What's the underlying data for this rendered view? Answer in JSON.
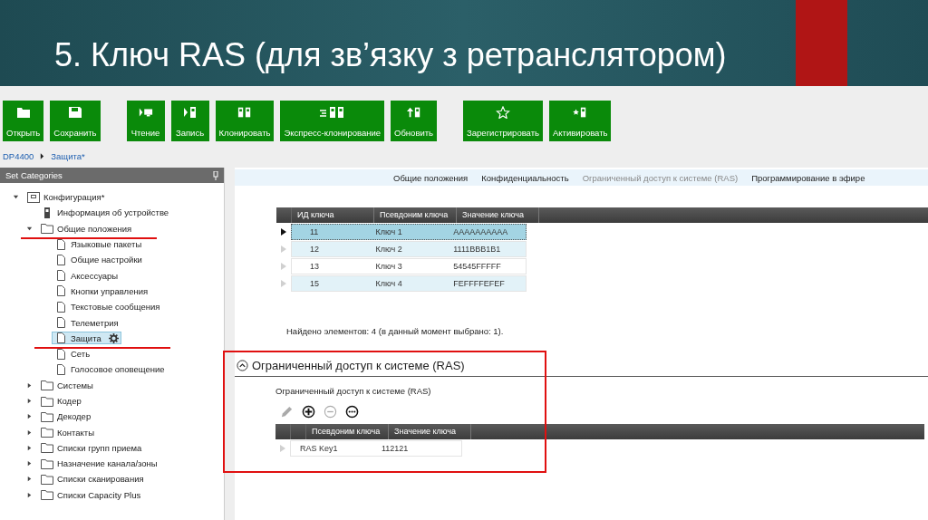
{
  "slide": {
    "title": "5. Ключ RAS (для зв’язку з ретранслятором)"
  },
  "toolbar": [
    [
      {
        "label": "Открыть",
        "kind": "open"
      },
      {
        "label": "Сохранить",
        "kind": "save"
      }
    ],
    [
      {
        "label": "Чтение",
        "kind": "read"
      },
      {
        "label": "Запись",
        "kind": "write"
      },
      {
        "label": "Клонировать",
        "kind": "clone"
      },
      {
        "label": "Экспресс-клонирование",
        "kind": "express"
      },
      {
        "label": "Обновить",
        "kind": "update"
      }
    ],
    [
      {
        "label": "Зарегистрировать",
        "kind": "register"
      },
      {
        "label": "Активировать",
        "kind": "activate"
      }
    ]
  ],
  "breadcrumb": [
    "DP4400",
    "Защита*"
  ],
  "sidebar": {
    "title": "Set Categories",
    "tree": [
      {
        "label": "Конфигурация*",
        "kind": "root",
        "expanded": true,
        "selected": false,
        "underlined": false,
        "children": [
          {
            "label": "Информация об устройстве",
            "kind": "device",
            "selected": false,
            "underlined": false
          },
          {
            "label": "Общие положения",
            "kind": "folder",
            "expanded": true,
            "selected": false,
            "underlined": true,
            "children": [
              {
                "label": "Языковые пакеты",
                "kind": "page",
                "selected": false,
                "underlined": false
              },
              {
                "label": "Общие настройки",
                "kind": "page",
                "selected": false,
                "underlined": false
              },
              {
                "label": "Аксессуары",
                "kind": "page",
                "selected": false,
                "underlined": false
              },
              {
                "label": "Кнопки управления",
                "kind": "page",
                "selected": false,
                "underlined": false
              },
              {
                "label": "Текстовые сообщения",
                "kind": "page",
                "selected": false,
                "underlined": false
              },
              {
                "label": "Телеметрия",
                "kind": "page",
                "selected": false,
                "underlined": false
              },
              {
                "label": "Защита",
                "kind": "page",
                "selected": true,
                "underlined": true
              },
              {
                "label": "Сеть",
                "kind": "page",
                "selected": false,
                "underlined": false
              },
              {
                "label": "Голосовое оповещение",
                "kind": "page",
                "selected": false,
                "underlined": false
              }
            ]
          },
          {
            "label": "Системы",
            "kind": "folder",
            "expanded": false,
            "selected": false,
            "underlined": false
          },
          {
            "label": "Кодер",
            "kind": "folder",
            "expanded": false,
            "selected": false,
            "underlined": false
          },
          {
            "label": "Декодер",
            "kind": "folder",
            "expanded": false,
            "selected": false,
            "underlined": false
          },
          {
            "label": "Контакты",
            "kind": "folder",
            "expanded": false,
            "selected": false,
            "underlined": false
          },
          {
            "label": "Списки групп приема",
            "kind": "folder",
            "expanded": false,
            "selected": false,
            "underlined": false
          },
          {
            "label": "Назначение канала/зоны",
            "kind": "folder",
            "expanded": false,
            "selected": false,
            "underlined": false
          },
          {
            "label": "Списки сканирования",
            "kind": "folder",
            "expanded": false,
            "selected": false,
            "underlined": false
          },
          {
            "label": "Списки Capacity Plus",
            "kind": "folder",
            "expanded": false,
            "selected": false,
            "underlined": false
          }
        ]
      }
    ]
  },
  "tabs": [
    {
      "label": "Общие положения",
      "selected": false
    },
    {
      "label": "Конфиденциальность",
      "selected": false
    },
    {
      "label": "Ограниченный доступ к системе (RAS)",
      "selected": true
    },
    {
      "label": "Программирование в эфире",
      "selected": false
    }
  ],
  "keys_table": {
    "columns": [
      "ИД ключа",
      "Псевдоним ключа",
      "Значение ключа"
    ],
    "rows": [
      {
        "cells": [
          "11",
          "Ключ 1",
          "AAAAAAAAAA"
        ],
        "selected": true
      },
      {
        "cells": [
          "12",
          "Ключ 2",
          "1111BBB1B1"
        ],
        "selected": false
      },
      {
        "cells": [
          "13",
          "Ключ 3",
          "54545FFFFF"
        ],
        "selected": false
      },
      {
        "cells": [
          "15",
          "Ключ 4",
          "FEFFFFEFEF"
        ],
        "selected": false
      }
    ]
  },
  "status": "Найдено элементов: 4 (в данный момент выбрано: 1).",
  "ras_section": {
    "title": "Ограниченный доступ к системе (RAS)",
    "expanded": true,
    "highlighted": true,
    "label": "Ограниченный доступ к системе (RAS)",
    "actions": [
      {
        "kind": "edit",
        "disabled": true
      },
      {
        "kind": "add",
        "disabled": false
      },
      {
        "kind": "remove",
        "disabled": true
      },
      {
        "kind": "more",
        "disabled": false
      }
    ],
    "table": {
      "columns": [
        "Псевдоним ключа",
        "Значение ключа"
      ],
      "rows": [
        {
          "cells": [
            "RAS Key1",
            "112121"
          ],
          "selected": false
        }
      ]
    }
  }
}
